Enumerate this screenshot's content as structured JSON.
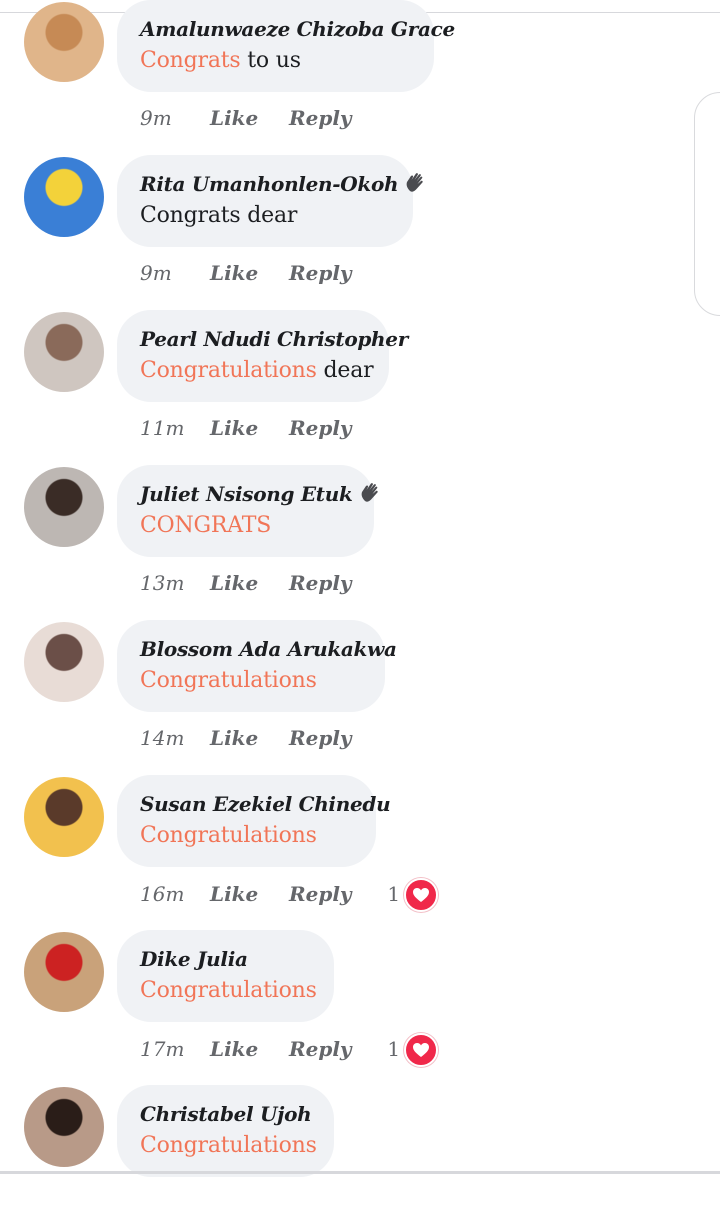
{
  "labels": {
    "like": "Like",
    "reply": "Reply"
  },
  "comments": [
    {
      "author": "Amalunwaeze Chizoba Grace",
      "highlight": "Congrats",
      "rest": " to us",
      "time": "9m",
      "reactions": "",
      "wave": false,
      "avatar_colors": [
        "#e0b58a",
        "#c68a55"
      ]
    },
    {
      "author": "Rita Umanhonlen-Okoh",
      "highlight": "",
      "rest": "Congrats dear",
      "time": "9m",
      "reactions": "",
      "wave": true,
      "avatar_colors": [
        "#3a7fd6",
        "#f3d23a"
      ]
    },
    {
      "author": "Pearl Ndudi Christopher",
      "highlight": "Congratulations",
      "rest": " dear",
      "time": "11m",
      "reactions": "",
      "wave": false,
      "avatar_colors": [
        "#cfc6c0",
        "#8a6a5a"
      ]
    },
    {
      "author": "Juliet Nsisong Etuk",
      "highlight": "CONGRATS",
      "rest": "",
      "time": "13m",
      "reactions": "",
      "wave": true,
      "avatar_colors": [
        "#bdb7b3",
        "#3a2c26"
      ]
    },
    {
      "author": "Blossom Ada Arukakwa",
      "highlight": "Congratulations",
      "rest": "",
      "time": "14m",
      "reactions": "",
      "wave": false,
      "avatar_colors": [
        "#e8dcd6",
        "#6b4f48"
      ]
    },
    {
      "author": "Susan Ezekiel Chinedu",
      "highlight": "Congratulations",
      "rest": "",
      "time": "16m",
      "reactions": "1",
      "wave": false,
      "avatar_colors": [
        "#f2c14e",
        "#5a3a2a"
      ]
    },
    {
      "author": "Dike Julia",
      "highlight": "Congratulations",
      "rest": "",
      "time": "17m",
      "reactions": "1",
      "wave": false,
      "avatar_colors": [
        "#c9a27a",
        "#cc2222"
      ]
    },
    {
      "author": "Christabel Ujoh",
      "highlight": "Congratulations",
      "rest": "",
      "time": "",
      "reactions": "",
      "wave": false,
      "avatar_colors": [
        "#b89a88",
        "#2a1d18"
      ]
    }
  ]
}
